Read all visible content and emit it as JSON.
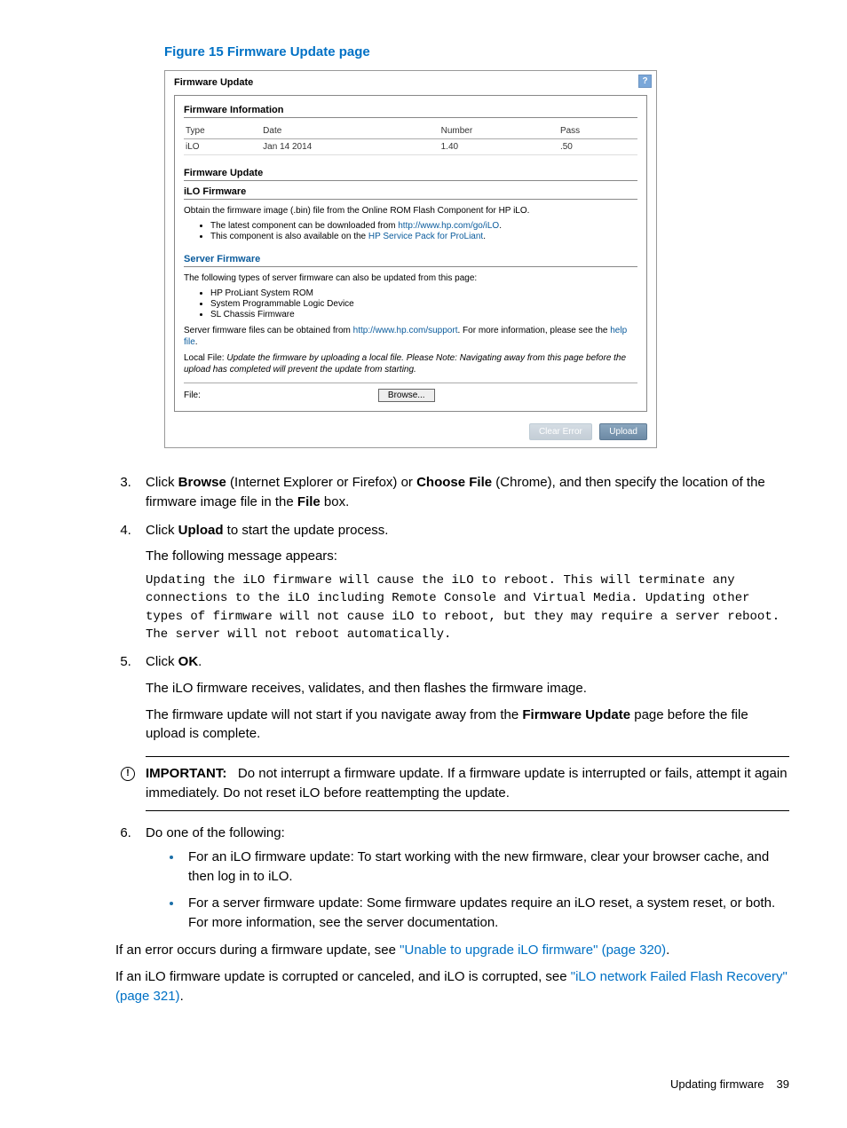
{
  "figure": {
    "caption": "Figure 15 Firmware Update page"
  },
  "screenshot": {
    "title": "Firmware Update",
    "info_heading": "Firmware Information",
    "table": {
      "headers": [
        "Type",
        "Date",
        "Number",
        "Pass"
      ],
      "row": [
        "iLO",
        "Jan 14 2014",
        "1.40",
        ".50"
      ]
    },
    "update_heading": "Firmware Update",
    "ilo_heading": "iLO Firmware",
    "ilo_intro": "Obtain the firmware image (.bin) file from the Online ROM Flash Component for HP iLO.",
    "ilo_bullets": {
      "b1a": "The latest component can be downloaded from ",
      "b1b": "http://www.hp.com/go/iLO",
      "b1c": ".",
      "b2a": "This component is also available on the ",
      "b2b": "HP Service Pack for ProLiant",
      "b2c": "."
    },
    "server_heading": "Server Firmware",
    "server_intro": "The following types of server firmware can also be updated from this page:",
    "server_bullets": {
      "s1": "HP ProLiant System ROM",
      "s2": "System Programmable Logic Device",
      "s3": "SL Chassis Firmware"
    },
    "obtain_a": "Server firmware files can be obtained from ",
    "obtain_b": "http://www.hp.com/support",
    "obtain_c": ". For more information, please see the ",
    "obtain_d": "help file",
    "obtain_e": ".",
    "local_a": "Local File:",
    "local_b": "Update the firmware by uploading a local file.  Please Note:   Navigating away from this page before the upload has completed will prevent the update from starting.",
    "file_label": "File:",
    "browse_btn": "Browse...",
    "clear_btn": "Clear Error",
    "upload_btn": "Upload"
  },
  "steps": {
    "s3a": "Click ",
    "s3b": "Browse",
    "s3c": " (Internet Explorer or Firefox) or ",
    "s3d": "Choose File",
    "s3e": " (Chrome), and then specify the location of the firmware image file in the ",
    "s3f": "File",
    "s3g": " box.",
    "s4a": "Click ",
    "s4b": "Upload",
    "s4c": " to start the update process.",
    "s4p": "The following message appears:",
    "s4mono": "Updating the iLO firmware will cause the iLO to reboot. This will terminate any connections to the iLO including Remote Console and Virtual Media. Updating other types of firmware will not cause iLO to reboot, but they may require a server reboot. The server will not reboot automatically.",
    "s5a": "Click ",
    "s5b": "OK",
    "s5c": ".",
    "s5p1": "The iLO firmware receives, validates, and then flashes the firmware image.",
    "s5p2a": "The firmware update will not start if you navigate away from the ",
    "s5p2b": "Firmware Update",
    "s5p2c": " page before the file upload is complete.",
    "s6": "Do one of the following:",
    "s6b1": "For an iLO firmware update: To start working with the new firmware, clear your browser cache, and then log in to iLO.",
    "s6b2": "For a server firmware update: Some firmware updates require an iLO reset, a system reset, or both. For more information, see the server documentation."
  },
  "important": {
    "label": "IMPORTANT:",
    "text": "Do not interrupt a firmware update. If a firmware update is interrupted or fails, attempt it again immediately. Do not reset iLO before reattempting the update."
  },
  "tail": {
    "p1a": "If an error occurs during a firmware update, see ",
    "p1b": "\"Unable to upgrade iLO firmware\" (page 320)",
    "p1c": ".",
    "p2a": "If an iLO firmware update is corrupted or canceled, and iLO is corrupted, see ",
    "p2b": "\"iLO network Failed Flash Recovery\" (page 321)",
    "p2c": "."
  },
  "footer": {
    "section": "Updating firmware",
    "page": "39"
  }
}
